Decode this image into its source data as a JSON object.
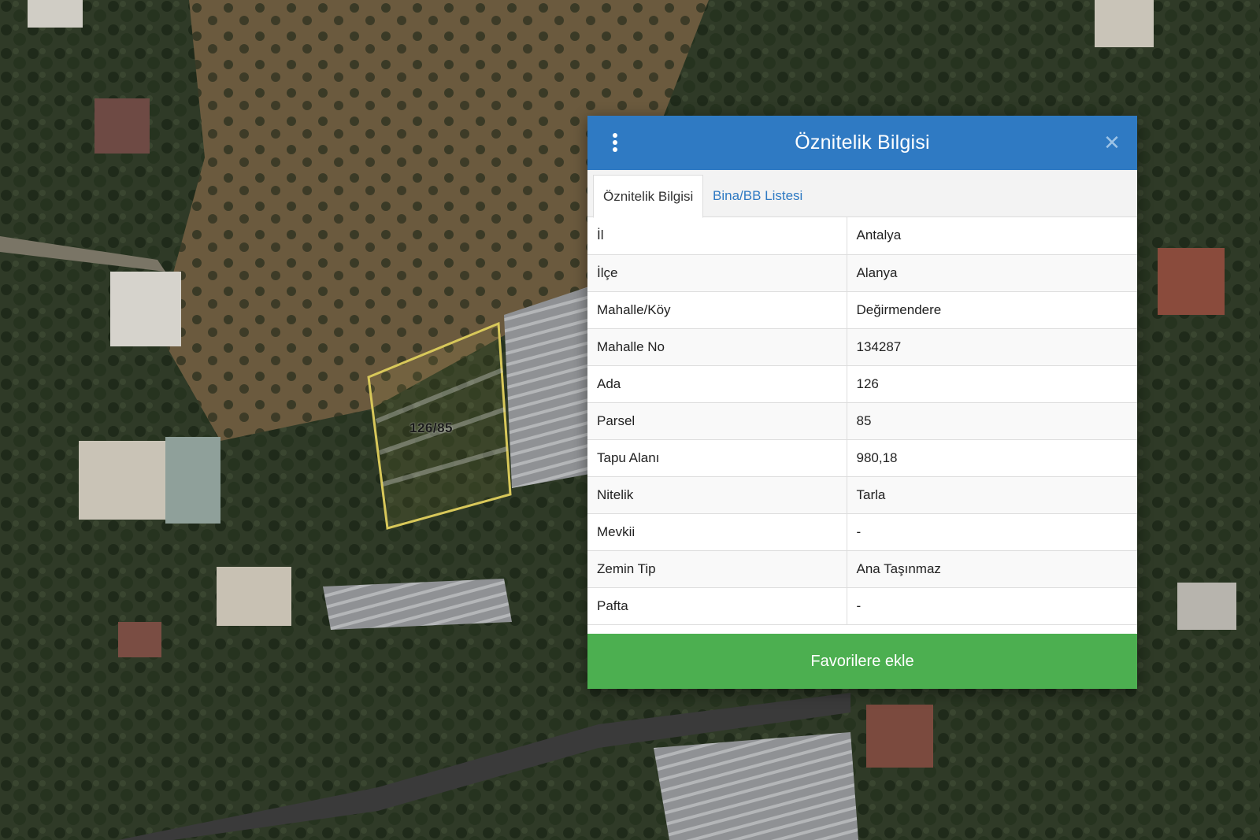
{
  "map": {
    "parcel_label": "126/85",
    "colors": {
      "parcel_outline": "#d8c85a",
      "vegetation": "#2c3a24",
      "soil": "#6b5a3e",
      "road": "#3c3c3c",
      "greenhouse": "#9a9c9e"
    }
  },
  "popup": {
    "title": "Öznitelik Bilgisi",
    "menu_icon": "kebab-menu-icon",
    "close_icon": "close-icon",
    "close_glyph": "✕",
    "header_color": "#2f7ac3",
    "tabs": [
      {
        "label": "Öznitelik Bilgisi",
        "active": true
      },
      {
        "label": "Bina/BB Listesi",
        "active": false
      }
    ],
    "rows": [
      {
        "key": "İl",
        "value": "Antalya"
      },
      {
        "key": "İlçe",
        "value": "Alanya"
      },
      {
        "key": "Mahalle/Köy",
        "value": "Değirmendere"
      },
      {
        "key": "Mahalle No",
        "value": "134287"
      },
      {
        "key": "Ada",
        "value": "126"
      },
      {
        "key": "Parsel",
        "value": "85"
      },
      {
        "key": "Tapu Alanı",
        "value": "980,18"
      },
      {
        "key": "Nitelik",
        "value": "Tarla"
      },
      {
        "key": "Mevkii",
        "value": "-"
      },
      {
        "key": "Zemin Tip",
        "value": "Ana Taşınmaz"
      },
      {
        "key": "Pafta",
        "value": "-"
      }
    ],
    "favorite_button": "Favorilere ekle",
    "favorite_color": "#4caf50"
  }
}
